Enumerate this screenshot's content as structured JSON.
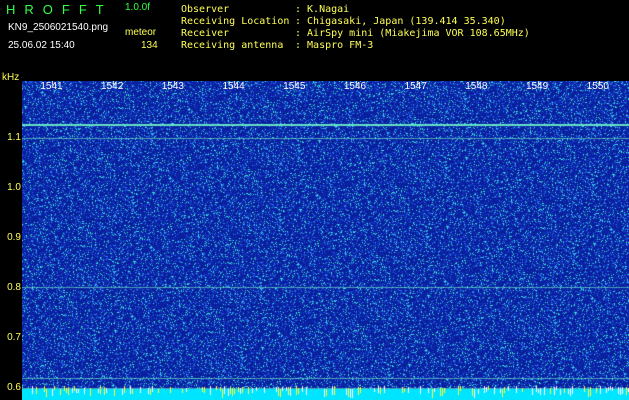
{
  "header": {
    "brand": "HROFFT",
    "version": "1.0.0f",
    "filename": "KN9_2506021540.png",
    "datetime": "25.06.02 15:40",
    "meteor_label": "meteor",
    "meteor_count": "134"
  },
  "info": [
    {
      "label": "Observer",
      "value": ": K.Nagai"
    },
    {
      "label": "Receiving Location",
      "value": ": Chigasaki, Japan (139.414 35.340)"
    },
    {
      "label": "Receiver",
      "value": ": AirSpy mini (Miakejima VOR 108.65MHz)"
    },
    {
      "label": "Receiving antenna",
      "value": ": Maspro FM-3"
    }
  ],
  "chart_data": {
    "type": "heatmap",
    "ylabel": "kHz",
    "ylim": [
      0.575,
      1.215
    ],
    "yticks": [
      "1.1",
      "1.0",
      "0.9",
      "0.8",
      "0.7",
      "0.6"
    ],
    "ytick_values": [
      1.1,
      1.0,
      0.9,
      0.8,
      0.7,
      0.6
    ],
    "xticks": [
      "1541",
      "1542",
      "1543",
      "1544",
      "1545",
      "1546",
      "1547",
      "1548",
      "1549",
      "1550"
    ],
    "xtick_values": [
      1541,
      1542,
      1543,
      1544,
      1545,
      1546,
      1547,
      1548,
      1549,
      1550
    ],
    "xlim": [
      1540.5,
      1550.5
    ],
    "carrier_lines_khz": [
      1.128,
      1.1,
      0.802,
      0.62,
      0.6
    ],
    "background_color": "#0a1f9e",
    "line_color": "#6ff5c8",
    "bottom_band_color": "#00e5ff",
    "grid": false
  },
  "colors": {
    "header_green": "#33ff44",
    "label_yellow": "#ffff55",
    "text_white": "#ffffff"
  }
}
